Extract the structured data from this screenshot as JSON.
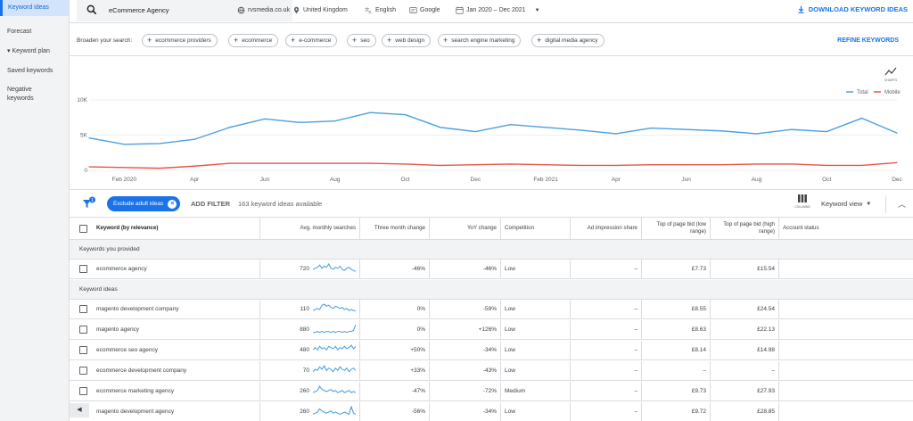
{
  "sidebar": {
    "items": [
      {
        "label": "Keyword ideas"
      },
      {
        "label": "Forecast"
      },
      {
        "label": "▾ Keyword plan"
      },
      {
        "label": "Saved keywords"
      },
      {
        "label": "Negative keywords"
      }
    ]
  },
  "topbar": {
    "search_value": "eCommerce Agency",
    "site": "rvsmedia.co.uk",
    "location": "United Kingdom",
    "language": "English",
    "network": "Google",
    "date_range": "Jan 2020 – Dec 2021",
    "download_label": "DOWNLOAD KEYWORD IDEAS"
  },
  "broaden": {
    "label": "Broaden your search:",
    "chips": [
      "ecommerce providers",
      "ecommerce",
      "e-commerce",
      "seo",
      "web design",
      "search engine marketing",
      "digital media agency"
    ],
    "refine_label": "REFINE KEYWORDS"
  },
  "chart": {
    "icon_label": "CHARTS",
    "legend": [
      {
        "name": "Total",
        "color": "#4a9fe0"
      },
      {
        "name": "Mobile",
        "color": "#e8544b"
      }
    ]
  },
  "chart_data": {
    "type": "line",
    "x": [
      "Jan 2020",
      "Feb 2020",
      "Mar 2020",
      "Apr 2020",
      "May 2020",
      "Jun 2020",
      "Jul 2020",
      "Aug 2020",
      "Sep 2020",
      "Oct 2020",
      "Nov 2020",
      "Dec 2020",
      "Jan 2021",
      "Feb 2021",
      "Mar 2021",
      "Apr 2021",
      "May 2021",
      "Jun 2021",
      "Jul 2021",
      "Aug 2021",
      "Sep 2021",
      "Oct 2021",
      "Nov 2021",
      "Dec 2021"
    ],
    "tick_labels": [
      "Feb 2020",
      "Apr",
      "Jun",
      "Aug",
      "Oct",
      "Dec",
      "Feb 2021",
      "Apr",
      "Jun",
      "Aug",
      "Oct",
      "Dec"
    ],
    "y_ticks": [
      "10K",
      "5K",
      "0"
    ],
    "ylim": [
      0,
      10000
    ],
    "series": [
      {
        "name": "Total",
        "values": [
          4600,
          3700,
          3800,
          4400,
          6100,
          7300,
          6800,
          7000,
          8200,
          7900,
          6100,
          5500,
          6500,
          6100,
          5700,
          5200,
          6000,
          5800,
          5600,
          5200,
          5800,
          5500,
          7400,
          5300
        ]
      },
      {
        "name": "Mobile",
        "values": [
          500,
          400,
          300,
          600,
          1000,
          1000,
          1000,
          1000,
          1000,
          900,
          700,
          800,
          900,
          800,
          700,
          700,
          800,
          800,
          800,
          900,
          900,
          700,
          700,
          1100
        ]
      }
    ],
    "legend": "top-right",
    "grid": true
  },
  "filter": {
    "exclude_label": "Exclude adult ideas",
    "filter_badge": "1",
    "add_filter_label": "ADD FILTER",
    "available_text": "163 keyword ideas available",
    "columns_label": "COLUMNS",
    "view_label": "Keyword view"
  },
  "table": {
    "headers": [
      "Keyword (by relevance)",
      "Avg. monthly searches",
      "Three month change",
      "YoY change",
      "Competition",
      "Ad impression share",
      "Top of page bid (low range)",
      "Top of page bid (high range)",
      "Account status"
    ],
    "provided_section": "Keywords you provided",
    "ideas_section": "Keyword ideas",
    "provided_rows": [
      {
        "keyword": "ecommerce agency",
        "searches": "720",
        "three_month": "-46%",
        "yoy": "-46%",
        "competition": "Low",
        "impression": "–",
        "bid_low": "£7.73",
        "bid_high": "£15.54",
        "trend": [
          5,
          6,
          7,
          9,
          6,
          8,
          7,
          10,
          6,
          5,
          7,
          6,
          8,
          5,
          4,
          6,
          7,
          5,
          4,
          3
        ]
      }
    ],
    "idea_rows": [
      {
        "keyword": "magento development company",
        "searches": "110",
        "three_month": "0%",
        "yoy": "-59%",
        "competition": "Low",
        "impression": "–",
        "bid_low": "£8.55",
        "bid_high": "£24.54",
        "trend": [
          4,
          5,
          6,
          5,
          9,
          10,
          8,
          9,
          7,
          6,
          8,
          7,
          6,
          7,
          5,
          6,
          4,
          5,
          4,
          4
        ]
      },
      {
        "keyword": "magento agency",
        "searches": "880",
        "three_month": "0%",
        "yoy": "+126%",
        "competition": "Low",
        "impression": "–",
        "bid_low": "£8.63",
        "bid_high": "£22.13",
        "trend": [
          3,
          3,
          4,
          3,
          4,
          3,
          4,
          4,
          3,
          4,
          3,
          4,
          4,
          3,
          4,
          3,
          4,
          4,
          5,
          11
        ]
      },
      {
        "keyword": "ecommerce seo agency",
        "searches": "480",
        "three_month": "+50%",
        "yoy": "-34%",
        "competition": "Low",
        "impression": "–",
        "bid_low": "£8.14",
        "bid_high": "£14.98",
        "trend": [
          5,
          7,
          5,
          8,
          6,
          7,
          5,
          8,
          7,
          6,
          8,
          5,
          7,
          6,
          8,
          6,
          7,
          9,
          6,
          8
        ]
      },
      {
        "keyword": "ecommerce development company",
        "searches": "70",
        "three_month": "+33%",
        "yoy": "-43%",
        "competition": "Low",
        "impression": "–",
        "bid_low": "–",
        "bid_high": "–",
        "trend": [
          4,
          6,
          5,
          8,
          6,
          9,
          5,
          7,
          6,
          4,
          7,
          5,
          8,
          6,
          5,
          7,
          4,
          6,
          7,
          5
        ]
      },
      {
        "keyword": "ecommerce marketing agency",
        "searches": "260",
        "three_month": "-47%",
        "yoy": "-72%",
        "competition": "Medium",
        "impression": "–",
        "bid_low": "£9.73",
        "bid_high": "£27.93",
        "trend": [
          4,
          5,
          6,
          10,
          7,
          6,
          5,
          6,
          7,
          5,
          6,
          4,
          5,
          6,
          4,
          5,
          6,
          4,
          5,
          4
        ]
      },
      {
        "keyword": "magento development agency",
        "searches": "260",
        "three_month": "-56%",
        "yoy": "-34%",
        "competition": "Low",
        "impression": "–",
        "bid_low": "£9.72",
        "bid_high": "£28.85",
        "trend": [
          3,
          4,
          5,
          8,
          6,
          5,
          4,
          5,
          6,
          4,
          5,
          4,
          3,
          4,
          5,
          4,
          3,
          10,
          4,
          3
        ]
      }
    ]
  }
}
